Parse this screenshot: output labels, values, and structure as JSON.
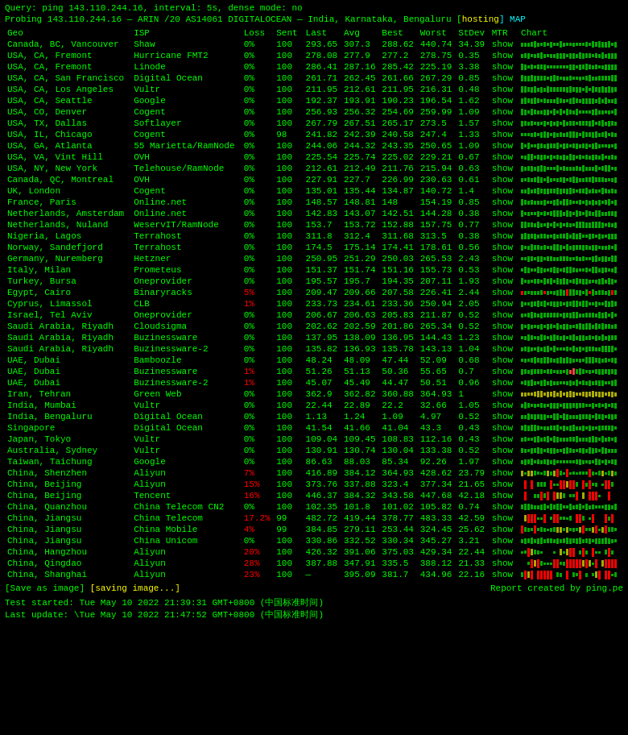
{
  "query_line": "Query: ping 143.110.244.16, interval: 5s, dense mode: no",
  "probe_line_prefix": "Probing 143.110.244.16 — ARIN /20 AS14061 DIGITALOCEAN — India, Karnataka, Bengaluru [",
  "probe_hosting": "hosting",
  "probe_map": "] MAP",
  "headers": {
    "geo": "Geo",
    "isp": "ISP",
    "loss": "Loss",
    "sent": "Sent",
    "last": "Last",
    "avg": "Avg",
    "best": "Best",
    "worst": "Worst",
    "stdev": "StDev",
    "mtr": "MTR",
    "chart": "Chart"
  },
  "rows": [
    {
      "geo": "Canada, BC, Vancouver",
      "isp": "Shaw",
      "loss": "0%",
      "sent": "100",
      "last": "293.65",
      "avg": "307.3",
      "best": "288.62",
      "worst": "440.74",
      "stdev": "34.39",
      "mtr": "show",
      "chart_type": "green_bars",
      "loss_color": "green"
    },
    {
      "geo": "USA, CA, Fremont",
      "isp": "Hurricane FMT2",
      "loss": "0%",
      "sent": "100",
      "last": "278.08",
      "avg": "277.9",
      "best": "277.2",
      "worst": "278.75",
      "stdev": "0.35",
      "mtr": "show",
      "chart_type": "green_bars",
      "loss_color": "green"
    },
    {
      "geo": "USA, CA, Fremont",
      "isp": "Linode",
      "loss": "0%",
      "sent": "100",
      "last": "286.41",
      "avg": "287.16",
      "best": "285.42",
      "worst": "225.19",
      "stdev": "3.38",
      "mtr": "show",
      "chart_type": "green_bars",
      "loss_color": "green"
    },
    {
      "geo": "USA, CA, San Francisco",
      "isp": "Digital Ocean",
      "loss": "0%",
      "sent": "100",
      "last": "261.71",
      "avg": "262.45",
      "best": "261.66",
      "worst": "267.29",
      "stdev": "0.85",
      "mtr": "show",
      "chart_type": "green_bars",
      "loss_color": "green"
    },
    {
      "geo": "USA, CA, Los Angeles",
      "isp": "Vultr",
      "loss": "0%",
      "sent": "100",
      "last": "211.95",
      "avg": "212.61",
      "best": "211.95",
      "worst": "216.31",
      "stdev": "0.48",
      "mtr": "show",
      "chart_type": "green_bars",
      "loss_color": "green"
    },
    {
      "geo": "USA, CA, Seattle",
      "isp": "Google",
      "loss": "0%",
      "sent": "100",
      "last": "192.37",
      "avg": "193.91",
      "best": "190.23",
      "worst": "196.54",
      "stdev": "1.62",
      "mtr": "show",
      "chart_type": "green_bars",
      "loss_color": "green"
    },
    {
      "geo": "USA, CO, Denver",
      "isp": "Cogent",
      "loss": "0%",
      "sent": "100",
      "last": "256.93",
      "avg": "256.32",
      "best": "254.69",
      "worst": "259.99",
      "stdev": "1.09",
      "mtr": "show",
      "chart_type": "green_bars",
      "loss_color": "green"
    },
    {
      "geo": "USA, TX, Dallas",
      "isp": "Softlayer",
      "loss": "0%",
      "sent": "100",
      "last": "267.79",
      "avg": "267.51",
      "best": "265.17",
      "worst": "273.5",
      "stdev": "1.57",
      "mtr": "show",
      "chart_type": "green_bars",
      "loss_color": "green"
    },
    {
      "geo": "USA, IL, Chicago",
      "isp": "Cogent",
      "loss": "0%",
      "sent": "98",
      "last": "241.82",
      "avg": "242.39",
      "best": "240.58",
      "worst": "247.4",
      "stdev": "1.33",
      "mtr": "show",
      "chart_type": "green_bars",
      "loss_color": "green"
    },
    {
      "geo": "USA, GA, Atlanta",
      "isp": "55 Marietta/RamNode",
      "loss": "0%",
      "sent": "100",
      "last": "244.06",
      "avg": "244.32",
      "best": "243.35",
      "worst": "250.65",
      "stdev": "1.09",
      "mtr": "show",
      "chart_type": "green_bars",
      "loss_color": "green"
    },
    {
      "geo": "USA, VA, Vint Hill",
      "isp": "OVH",
      "loss": "0%",
      "sent": "100",
      "last": "225.54",
      "avg": "225.74",
      "best": "225.02",
      "worst": "229.21",
      "stdev": "0.67",
      "mtr": "show",
      "chart_type": "green_bars",
      "loss_color": "green"
    },
    {
      "geo": "USA, NY, New York",
      "isp": "Telehouse/RamNode",
      "loss": "0%",
      "sent": "100",
      "last": "212.61",
      "avg": "212.49",
      "best": "211.76",
      "worst": "215.94",
      "stdev": "0.63",
      "mtr": "show",
      "chart_type": "green_bars",
      "loss_color": "green"
    },
    {
      "geo": "Canada, QC, Montreal",
      "isp": "OVH",
      "loss": "0%",
      "sent": "100",
      "last": "227.91",
      "avg": "227.7",
      "best": "226.99",
      "worst": "230.63",
      "stdev": "0.61",
      "mtr": "show",
      "chart_type": "green_bars",
      "loss_color": "green"
    },
    {
      "geo": "UK, London",
      "isp": "Cogent",
      "loss": "0%",
      "sent": "100",
      "last": "135.01",
      "avg": "135.44",
      "best": "134.87",
      "worst": "140.72",
      "stdev": "1.4",
      "mtr": "show",
      "chart_type": "green_bars",
      "loss_color": "green"
    },
    {
      "geo": "France, Paris",
      "isp": "Online.net",
      "loss": "0%",
      "sent": "100",
      "last": "148.57",
      "avg": "148.81",
      "best": "148",
      "worst": "154.19",
      "stdev": "0.85",
      "mtr": "show",
      "chart_type": "green_bars",
      "loss_color": "green"
    },
    {
      "geo": "Netherlands, Amsterdam",
      "isp": "Online.net",
      "loss": "0%",
      "sent": "100",
      "last": "142.83",
      "avg": "143.07",
      "best": "142.51",
      "worst": "144.28",
      "stdev": "0.38",
      "mtr": "show",
      "chart_type": "green_bars",
      "loss_color": "green"
    },
    {
      "geo": "Netherlands, Nuland",
      "isp": "WeservIT/RamNode",
      "loss": "0%",
      "sent": "100",
      "last": "153.7",
      "avg": "153.72",
      "best": "152.88",
      "worst": "157.75",
      "stdev": "0.77",
      "mtr": "show",
      "chart_type": "green_bars",
      "loss_color": "green"
    },
    {
      "geo": "Nigeria, Lagos",
      "isp": "Terrahost",
      "loss": "0%",
      "sent": "100",
      "last": "311.8",
      "avg": "312.4",
      "best": "311.68",
      "worst": "313.5",
      "stdev": "0.38",
      "mtr": "show",
      "chart_type": "green_bars",
      "loss_color": "green"
    },
    {
      "geo": "Norway, Sandefjord",
      "isp": "Terrahost",
      "loss": "0%",
      "sent": "100",
      "last": "174.5",
      "avg": "175.14",
      "best": "174.41",
      "worst": "178.61",
      "stdev": "0.56",
      "mtr": "show",
      "chart_type": "green_bars",
      "loss_color": "green"
    },
    {
      "geo": "Germany, Nuremberg",
      "isp": "Hetzner",
      "loss": "0%",
      "sent": "100",
      "last": "250.95",
      "avg": "251.29",
      "best": "250.03",
      "worst": "265.53",
      "stdev": "2.43",
      "mtr": "show",
      "chart_type": "green_bars",
      "loss_color": "green"
    },
    {
      "geo": "Italy, Milan",
      "isp": "Prometeus",
      "loss": "0%",
      "sent": "100",
      "last": "151.37",
      "avg": "151.74",
      "best": "151.16",
      "worst": "155.73",
      "stdev": "0.53",
      "mtr": "show",
      "chart_type": "green_bars",
      "loss_color": "green"
    },
    {
      "geo": "Turkey, Bursa",
      "isp": "Oneprovider",
      "loss": "0%",
      "sent": "100",
      "last": "195.57",
      "avg": "195.7",
      "best": "194.35",
      "worst": "207.11",
      "stdev": "1.93",
      "mtr": "show",
      "chart_type": "green_bars",
      "loss_color": "green"
    },
    {
      "geo": "Egypt, Cairo",
      "isp": "Binaryracks",
      "loss": "5%",
      "sent": "100",
      "last": "209.47",
      "avg": "209.66",
      "best": "207.58",
      "worst": "226.41",
      "stdev": "2.44",
      "mtr": "show",
      "chart_type": "mostly_green",
      "loss_color": "red"
    },
    {
      "geo": "Cyprus, Limassol",
      "isp": "CLB",
      "loss": "1%",
      "sent": "100",
      "last": "233.73",
      "avg": "234.61",
      "best": "233.36",
      "worst": "250.94",
      "stdev": "2.05",
      "mtr": "show",
      "chart_type": "green_bars",
      "loss_color": "red"
    },
    {
      "geo": "Israel, Tel Aviv",
      "isp": "Oneprovider",
      "loss": "0%",
      "sent": "100",
      "last": "206.67",
      "avg": "206.63",
      "best": "205.83",
      "worst": "211.87",
      "stdev": "0.52",
      "mtr": "show",
      "chart_type": "green_bars",
      "loss_color": "green"
    },
    {
      "geo": "Saudi Arabia, Riyadh",
      "isp": "Cloudsigma",
      "loss": "0%",
      "sent": "100",
      "last": "202.62",
      "avg": "202.59",
      "best": "201.86",
      "worst": "265.34",
      "stdev": "0.52",
      "mtr": "show",
      "chart_type": "green_bars",
      "loss_color": "green"
    },
    {
      "geo": "Saudi Arabia, Riyadh",
      "isp": "Buzinessware",
      "loss": "0%",
      "sent": "100",
      "last": "137.95",
      "avg": "138.09",
      "best": "136.95",
      "worst": "144.43",
      "stdev": "1.23",
      "mtr": "show",
      "chart_type": "green_bars",
      "loss_color": "green"
    },
    {
      "geo": "Saudi Arabia, Riyadh",
      "isp": "Buzinessware-2",
      "loss": "0%",
      "sent": "100",
      "last": "135.82",
      "avg": "136.93",
      "best": "135.78",
      "worst": "143.13",
      "stdev": "1.04",
      "mtr": "show",
      "chart_type": "green_bars",
      "loss_color": "green"
    },
    {
      "geo": "UAE, Dubai",
      "isp": "Bamboozle",
      "loss": "0%",
      "sent": "100",
      "last": "48.24",
      "avg": "48.09",
      "best": "47.44",
      "worst": "52.09",
      "stdev": "0.68",
      "mtr": "show",
      "chart_type": "green_bars",
      "loss_color": "green"
    },
    {
      "geo": "UAE, Dubai",
      "isp": "Buzinessware",
      "loss": "1%",
      "sent": "100",
      "last": "51.26",
      "avg": "51.13",
      "best": "50.36",
      "worst": "55.65",
      "stdev": "0.7",
      "mtr": "show",
      "chart_type": "green_spike",
      "loss_color": "red"
    },
    {
      "geo": "UAE, Dubai",
      "isp": "Buzinessware-2",
      "loss": "1%",
      "sent": "100",
      "last": "45.07",
      "avg": "45.49",
      "best": "44.47",
      "worst": "50.51",
      "stdev": "0.96",
      "mtr": "show",
      "chart_type": "green_bars",
      "loss_color": "red"
    },
    {
      "geo": "Iran, Tehran",
      "isp": "Green Web",
      "loss": "0%",
      "sent": "100",
      "last": "362.9",
      "avg": "362.82",
      "best": "360.88",
      "worst": "364.93",
      "stdev": "1",
      "mtr": "show",
      "chart_type": "yellow_bars",
      "loss_color": "green"
    },
    {
      "geo": "India, Mumbai",
      "isp": "Vultr",
      "loss": "0%",
      "sent": "100",
      "last": "22.44",
      "avg": "22.89",
      "best": "22.2",
      "worst": "32.66",
      "stdev": "1.05",
      "mtr": "show",
      "chart_type": "green_bars",
      "loss_color": "green"
    },
    {
      "geo": "India, Bengaluru",
      "isp": "Digital Ocean",
      "loss": "0%",
      "sent": "100",
      "last": "1.13",
      "avg": "1.24",
      "best": "1.09",
      "worst": "4.97",
      "stdev": "0.52",
      "mtr": "show",
      "chart_type": "green_bars",
      "loss_color": "green"
    },
    {
      "geo": "Singapore",
      "isp": "Digital Ocean",
      "loss": "0%",
      "sent": "100",
      "last": "41.54",
      "avg": "41.66",
      "best": "41.04",
      "worst": "43.3",
      "stdev": "0.43",
      "mtr": "show",
      "chart_type": "green_bars",
      "loss_color": "green"
    },
    {
      "geo": "Japan, Tokyo",
      "isp": "Vultr",
      "loss": "0%",
      "sent": "100",
      "last": "109.04",
      "avg": "109.45",
      "best": "108.83",
      "worst": "112.16",
      "stdev": "0.43",
      "mtr": "show",
      "chart_type": "green_bars",
      "loss_color": "green"
    },
    {
      "geo": "Australia, Sydney",
      "isp": "Vultr",
      "loss": "0%",
      "sent": "100",
      "last": "130.91",
      "avg": "130.74",
      "best": "130.04",
      "worst": "133.38",
      "stdev": "0.52",
      "mtr": "show",
      "chart_type": "green_bars",
      "loss_color": "green"
    },
    {
      "geo": "Taiwan, Taichung",
      "isp": "Google",
      "loss": "0%",
      "sent": "100",
      "last": "86.63",
      "avg": "88.03",
      "best": "85.34",
      "worst": "92.26",
      "stdev": "1.97",
      "mtr": "show",
      "chart_type": "green_bars",
      "loss_color": "green"
    },
    {
      "geo": "China, Shenzhen",
      "isp": "Aliyun",
      "loss": "7%",
      "sent": "100",
      "last": "416.89",
      "avg": "384.12",
      "best": "364.93",
      "worst": "428.62",
      "stdev": "23.79",
      "mtr": "show",
      "chart_type": "mixed_bars",
      "loss_color": "red"
    },
    {
      "geo": "China, Beijing",
      "isp": "Aliyun",
      "loss": "15%",
      "sent": "100",
      "last": "373.76",
      "avg": "337.88",
      "best": "323.4",
      "worst": "377.34",
      "stdev": "21.65",
      "mtr": "show",
      "chart_type": "heavy_mixed",
      "loss_color": "red"
    },
    {
      "geo": "China, Beijing",
      "isp": "Tencent",
      "loss": "16%",
      "sent": "100",
      "last": "446.37",
      "avg": "384.32",
      "best": "343.58",
      "worst": "447.68",
      "stdev": "42.18",
      "mtr": "show",
      "chart_type": "heavy_mixed",
      "loss_color": "red"
    },
    {
      "geo": "China, Quanzhou",
      "isp": "China Telecom CN2",
      "loss": "0%",
      "sent": "100",
      "last": "102.35",
      "avg": "101.8",
      "best": "101.02",
      "worst": "105.82",
      "stdev": "0.74",
      "mtr": "show",
      "chart_type": "green_bars",
      "loss_color": "green"
    },
    {
      "geo": "China, Jiangsu",
      "isp": "China Telecom",
      "loss": "17.2%",
      "sent": "99",
      "last": "482.72",
      "avg": "419.44",
      "best": "378.77",
      "worst": "483.33",
      "stdev": "42.59",
      "mtr": "show",
      "chart_type": "heavy_mixed",
      "loss_color": "red"
    },
    {
      "geo": "China, Jiangsu",
      "isp": "China Mobile",
      "loss": "4%",
      "sent": "99",
      "last": "384.85",
      "avg": "279.11",
      "best": "253.44",
      "worst": "324.45",
      "stdev": "25.62",
      "mtr": "show",
      "chart_type": "mixed_bars",
      "loss_color": "red"
    },
    {
      "geo": "China, Jiangsu",
      "isp": "China Unicom",
      "loss": "0%",
      "sent": "100",
      "last": "330.86",
      "avg": "332.52",
      "best": "330.34",
      "worst": "345.27",
      "stdev": "3.21",
      "mtr": "show",
      "chart_type": "green_bars",
      "loss_color": "green"
    },
    {
      "geo": "China, Hangzhou",
      "isp": "Aliyun",
      "loss": "20%",
      "sent": "100",
      "last": "426.32",
      "avg": "391.06",
      "best": "375.03",
      "worst": "429.34",
      "stdev": "22.44",
      "mtr": "show",
      "chart_type": "heavy_mixed",
      "loss_color": "red"
    },
    {
      "geo": "China, Qingdao",
      "isp": "Aliyun",
      "loss": "28%",
      "sent": "100",
      "last": "387.88",
      "avg": "347.91",
      "best": "335.5",
      "worst": "388.12",
      "stdev": "21.33",
      "mtr": "show",
      "chart_type": "heavy_mixed",
      "loss_color": "red"
    },
    {
      "geo": "China, Shanghai",
      "isp": "Aliyun",
      "loss": "23%",
      "sent": "100",
      "last": "—",
      "avg": "395.09",
      "best": "381.7",
      "worst": "434.96",
      "stdev": "22.16",
      "mtr": "show",
      "chart_type": "heavy_mixed",
      "loss_color": "red"
    }
  ],
  "footer": {
    "save_label": "[Save as image]",
    "saving_label": "[saving image...]",
    "report_credit": "Report created by ping.pe",
    "time_started_label": "Test started:",
    "time_started": "Tue May 10 2022 21:39:31 GMT+0800 (中国标准时间)",
    "time_updated_label": "Last update:",
    "time_updated": "\\Tue May 10 2022 21:47:52 GMT+0800 (中国标准时间)"
  }
}
